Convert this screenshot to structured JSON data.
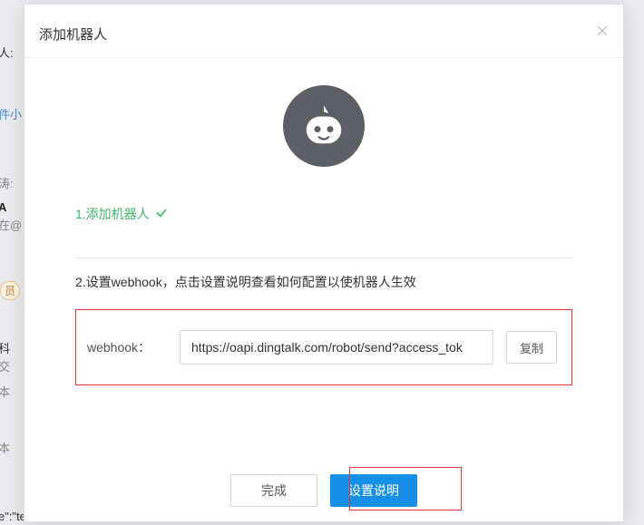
{
  "modal": {
    "title": "添加机器人",
    "step1_label": "1.添加机器人",
    "step2_label": "2.设置webhook，点击设置说明查看如何配置以使机器人生效",
    "webhook_label": "webhook：",
    "webhook_value": "https://oapi.dingtalk.com/robot/send?access_tok",
    "copy_label": "复制",
    "done_label": "完成",
    "settings_label": "设置说明"
  },
  "background": {
    "t1": "人:",
    "t2": "件小",
    "t3": "涛:",
    "t4": "A",
    "t5": "在@",
    "t6": "员",
    "t7": "科",
    "t8": "交",
    "t9": "本",
    "t10": "本",
    "t11": "e\":\"text\","
  }
}
